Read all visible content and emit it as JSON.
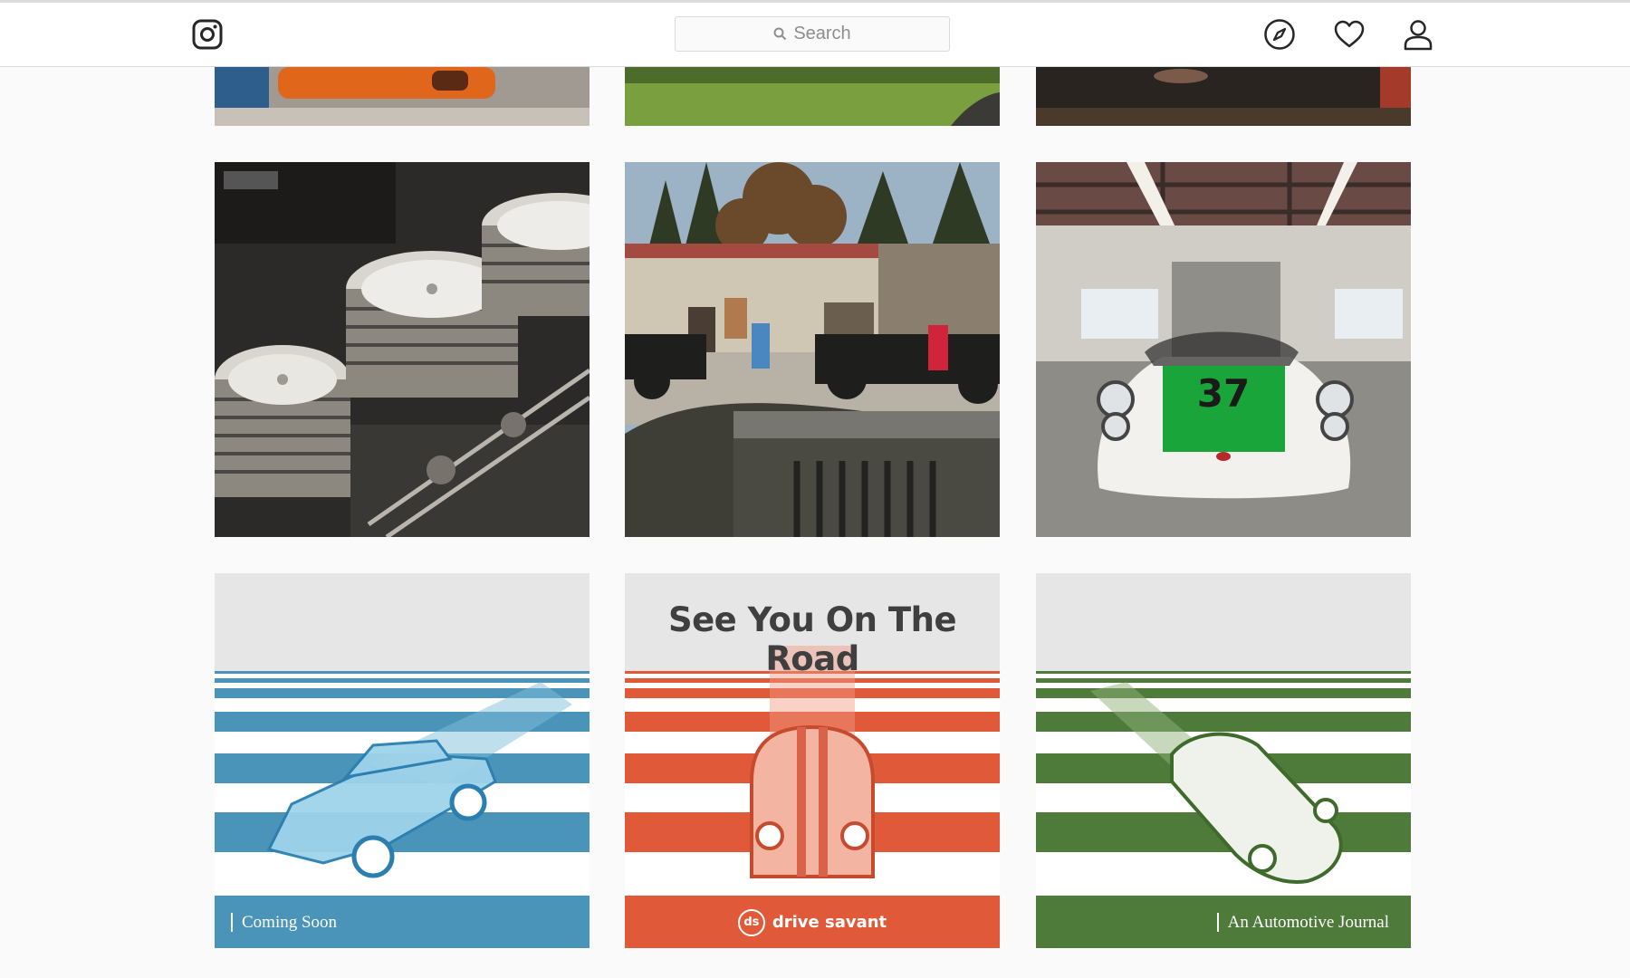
{
  "navbar": {
    "search_placeholder": "Search",
    "icons": [
      "instagram-logo-icon",
      "search-icon",
      "compass-icon",
      "heart-icon",
      "profile-icon"
    ]
  },
  "grid": {
    "posts": [
      {
        "description": "photo"
      },
      {
        "description": "photo"
      },
      {
        "description": "photo"
      },
      {
        "description": "photo"
      },
      {
        "description": "photo"
      },
      {
        "description": "photo",
        "race_number": "37"
      },
      {
        "caption": "Coming Soon",
        "accent": "#4a93b9"
      },
      {
        "title": "See You On The Road",
        "brand_mark": "ds",
        "brand_name": "drive savant",
        "accent": "#e05a3a"
      },
      {
        "caption": "An Automotive Journal",
        "accent": "#4e7a3a"
      }
    ]
  },
  "colors": {
    "page_bg": "#fafafa",
    "navbar_bg": "#ffffff",
    "border": "#dbdbdb",
    "poster_blue": "#4a93b9",
    "poster_orange": "#e05a3a",
    "poster_green": "#4e7a3a"
  }
}
